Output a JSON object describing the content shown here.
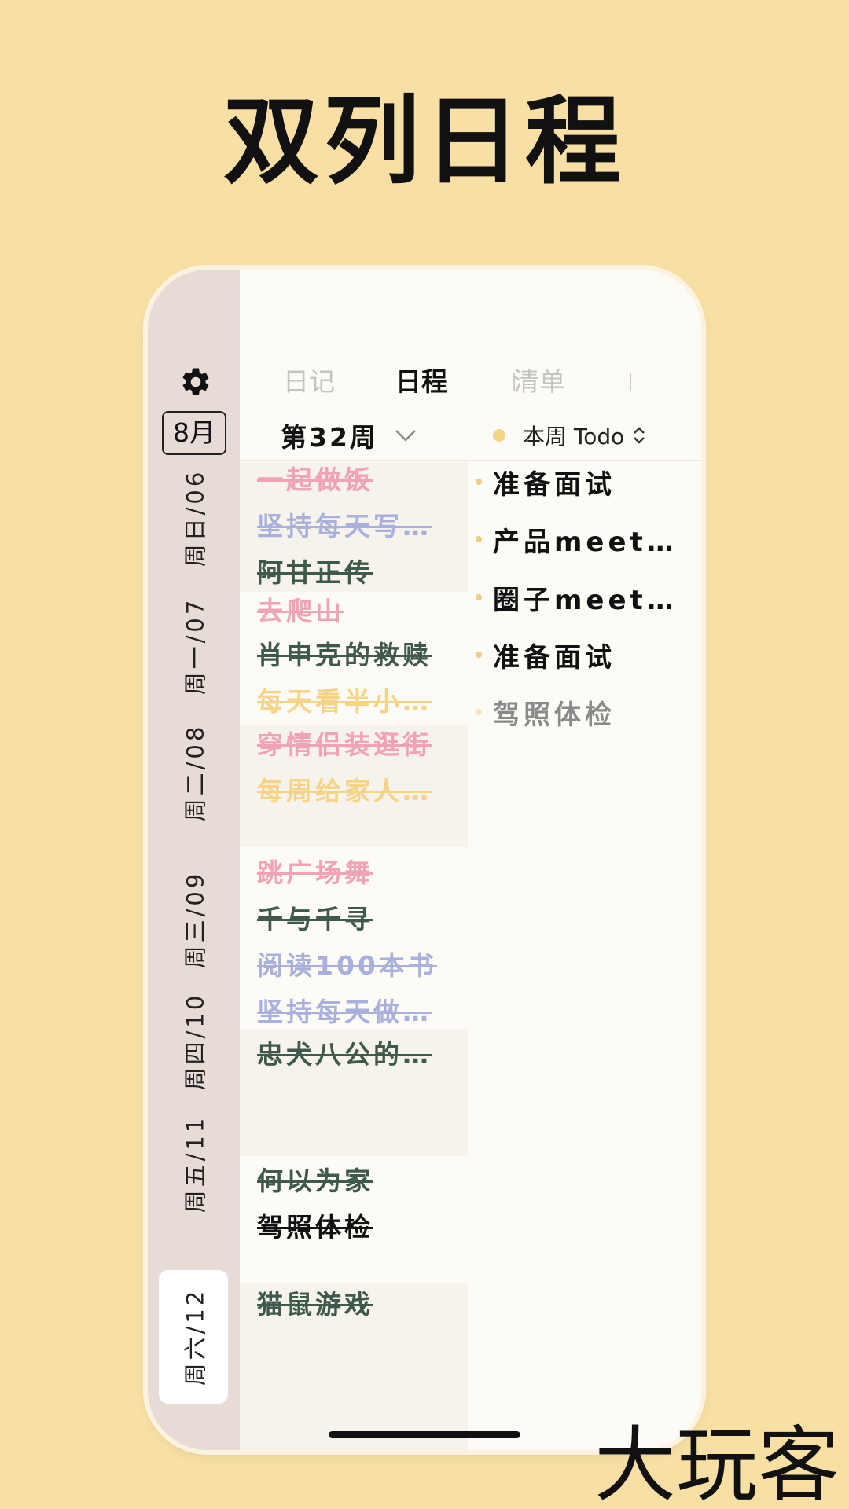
{
  "headline": "双列日程",
  "sidebar": {
    "month": "8月",
    "days": [
      {
        "label": "周日/06",
        "active": false
      },
      {
        "label": "周一/07",
        "active": false
      },
      {
        "label": "周二/08",
        "active": false
      },
      {
        "label": "周三/09",
        "active": false
      },
      {
        "label": "周四/10",
        "active": false
      },
      {
        "label": "周五/11",
        "active": false
      },
      {
        "label": "周六/12",
        "active": true
      }
    ]
  },
  "tabs": [
    {
      "label": "日记",
      "active": false
    },
    {
      "label": "日程",
      "active": true
    },
    {
      "label": "清单",
      "active": false
    }
  ],
  "week_selector": {
    "label": "第32周"
  },
  "todo_selector": {
    "label": "本周 Todo"
  },
  "events": [
    {
      "day": "周日/06",
      "items": [
        {
          "text": "一起做饭",
          "color": "#f0a3b3",
          "done": true
        },
        {
          "text": "坚持每天写…",
          "color": "#aab0dc",
          "done": true
        },
        {
          "text": "阿甘正传",
          "color": "#3f5a4a",
          "done": true
        }
      ]
    },
    {
      "day": "周一/07",
      "items": [
        {
          "text": "去爬山",
          "color": "#f0a3b3",
          "done": true
        },
        {
          "text": "肖申克的救赎",
          "color": "#3f5a4a",
          "done": true
        },
        {
          "text": "每天看半小…",
          "color": "#f5d488",
          "done": true
        }
      ]
    },
    {
      "day": "周二/08",
      "items": [
        {
          "text": "穿情侣装逛街",
          "color": "#f0a3b3",
          "done": true
        },
        {
          "text": "每周给家人…",
          "color": "#f5d488",
          "done": true
        }
      ]
    },
    {
      "day": "周三/09",
      "items": [
        {
          "text": "跳广场舞",
          "color": "#f0a3b3",
          "done": true
        },
        {
          "text": "千与千寻",
          "color": "#3f5a4a",
          "done": true
        },
        {
          "text": "阅读100本书",
          "color": "#aab0dc",
          "done": true
        },
        {
          "text": "坚持每天做…",
          "color": "#aab0dc",
          "done": true
        }
      ]
    },
    {
      "day": "周四/10",
      "items": [
        {
          "text": "忠犬八公的…",
          "color": "#3f5a4a",
          "done": true
        }
      ]
    },
    {
      "day": "周五/11",
      "items": [
        {
          "text": "何以为家",
          "color": "#3f5a4a",
          "done": true
        },
        {
          "text": "驾照体检",
          "color": "#111111",
          "done": true
        }
      ]
    },
    {
      "day": "周六/12",
      "items": [
        {
          "text": "猫鼠游戏",
          "color": "#3f5a4a",
          "done": true
        }
      ]
    }
  ],
  "todos": [
    {
      "text": "准备面试",
      "color": "#111111"
    },
    {
      "text": "产品meet…",
      "color": "#111111"
    },
    {
      "text": "圈子meet…",
      "color": "#111111"
    },
    {
      "text": "准备面试",
      "color": "#111111"
    },
    {
      "text": "驾照体检",
      "color": "#8a8a8a"
    }
  ],
  "watermark": "大玩客",
  "icons": {
    "settings": "gear-icon",
    "week_dropdown": "chevron-down-icon",
    "todo_sort": "updown-chevron-icon"
  }
}
